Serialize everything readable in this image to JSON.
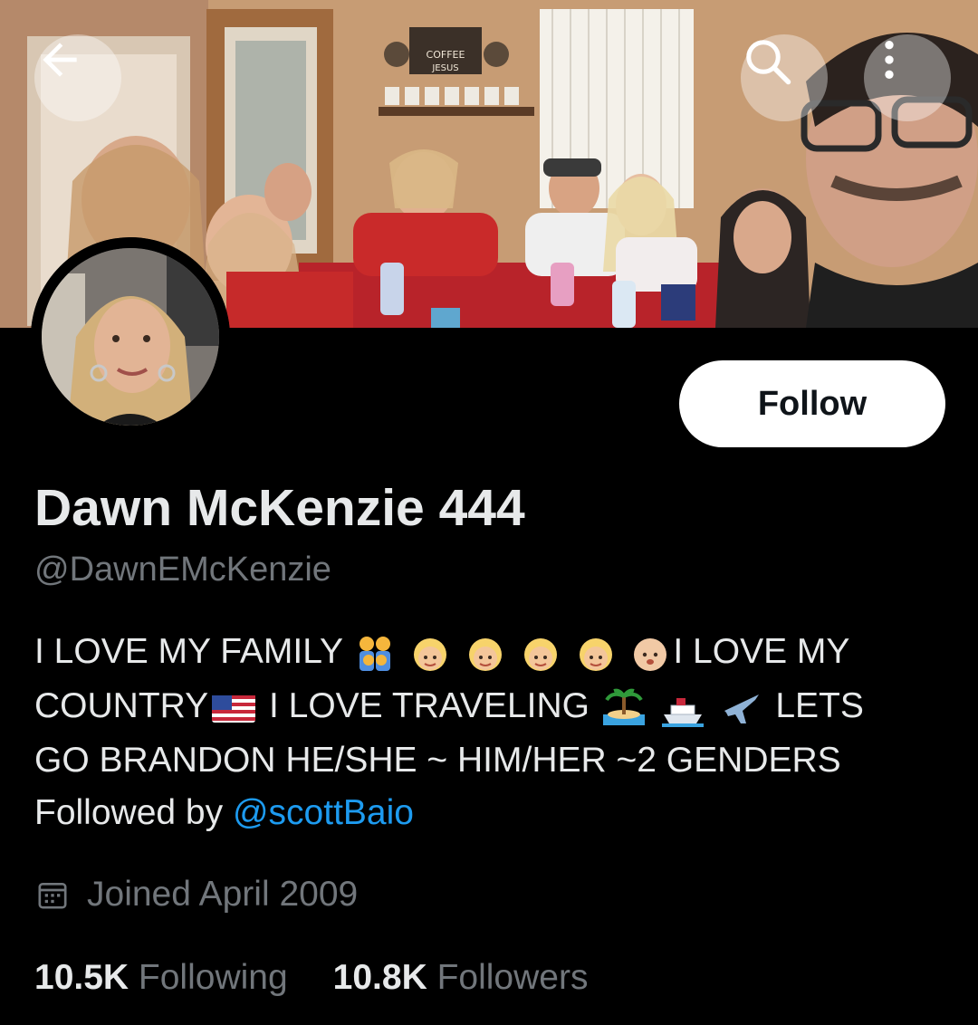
{
  "profile": {
    "display_name": "Dawn McKenzie 444",
    "handle": "@DawnEMcKenzie",
    "bio_lines": [
      "I LOVE MY FAMILY",
      "I LOVE MY",
      "COUNTRY",
      "I LOVE TRAVELING",
      "LETS",
      "GO BRANDON HE/SHE ~ HIM/HER ~2 GENDERS"
    ],
    "followed_by_prefix": "Followed by",
    "followed_by_user": "@scottBaio",
    "joined": "Joined April 2009"
  },
  "stats": {
    "following_count": "10.5K",
    "following_label": "Following",
    "followers_count": "10.8K",
    "followers_label": "Followers"
  },
  "actions": {
    "follow_label": "Follow"
  },
  "banner": {
    "sign_text": "COFFEE",
    "sign_text2": "JESUS"
  },
  "icons": {
    "back": "arrow-left-icon",
    "search": "search-icon",
    "more": "more-vertical-icon",
    "calendar": "calendar-icon"
  },
  "colors": {
    "background": "#000000",
    "primary_text": "#e7e9ea",
    "secondary_text": "#71767b",
    "link": "#1d9bf0",
    "follow_bg": "#ffffff"
  }
}
